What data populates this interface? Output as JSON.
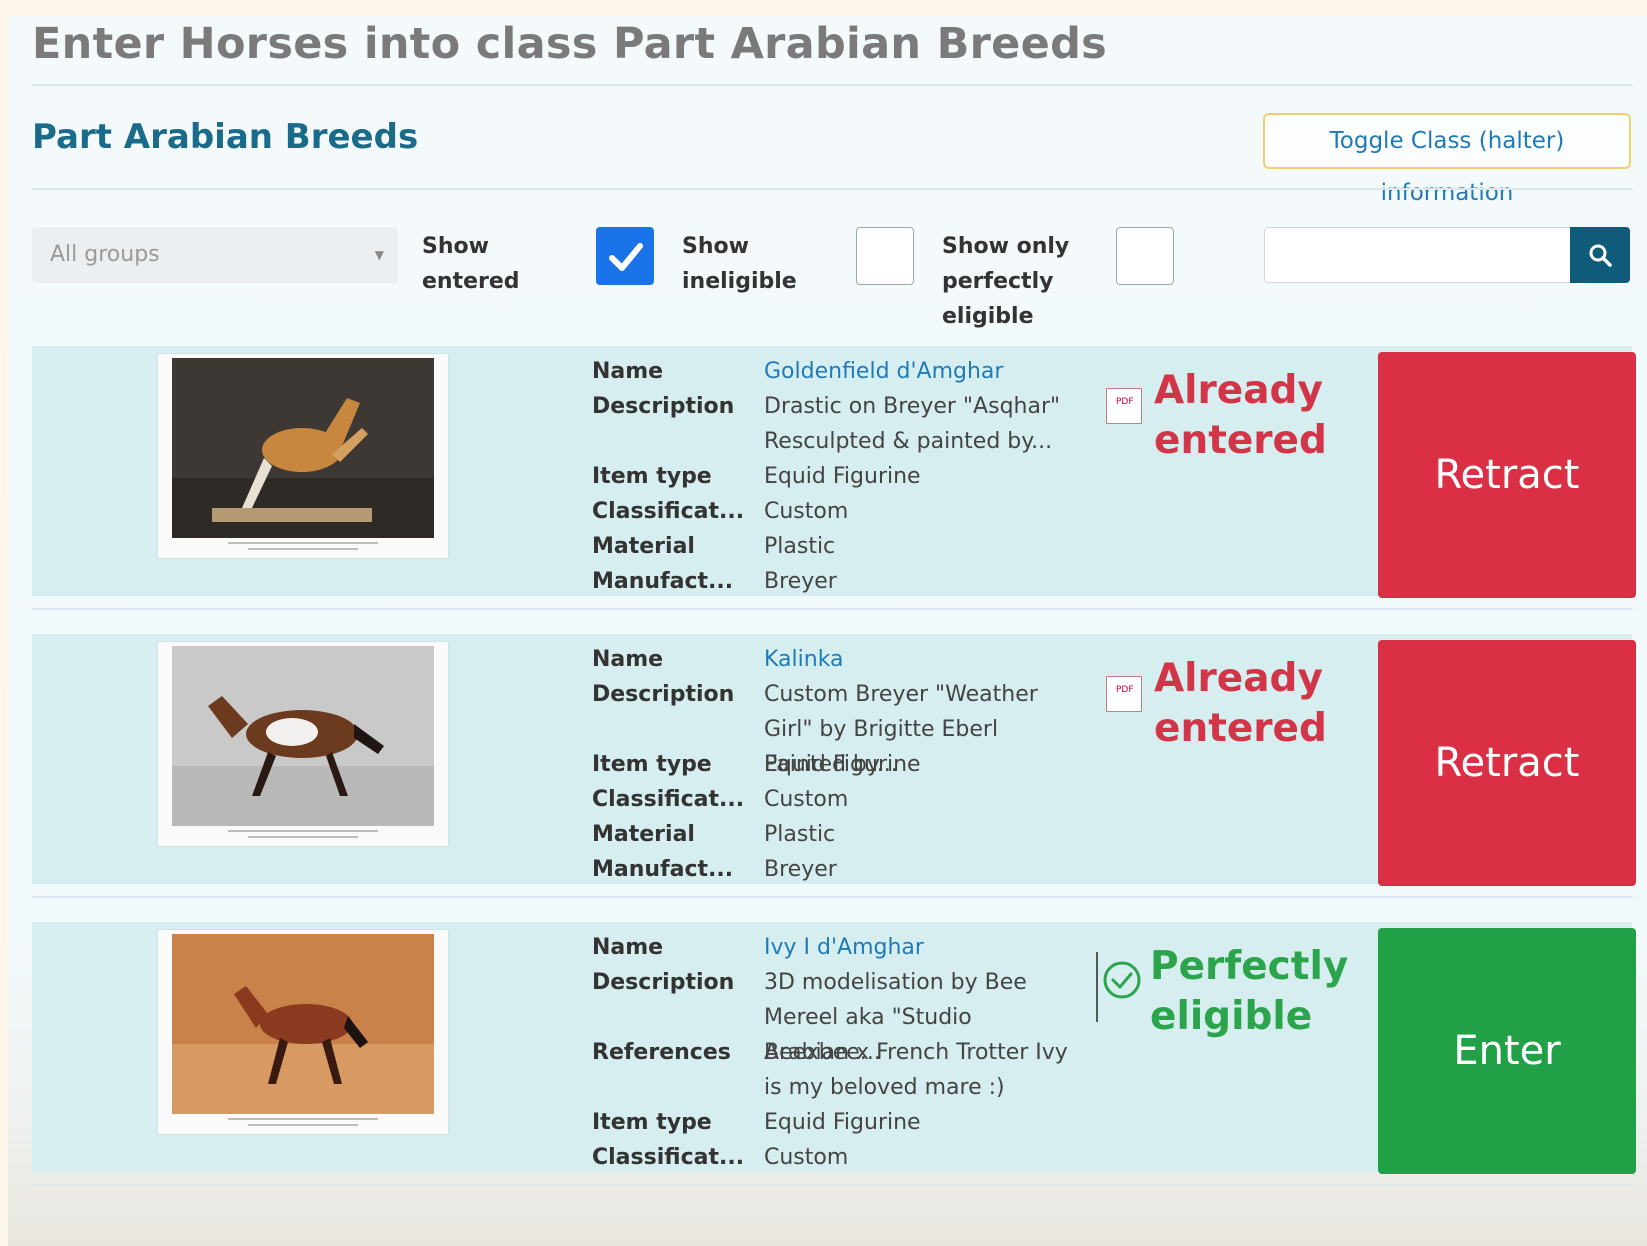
{
  "page_title": "Enter Horses into class Part Arabian Breeds",
  "class_title": "Part Arabian Breeds",
  "toggle_button": "Toggle Class (halter) information",
  "filters": {
    "group_select": "All groups",
    "show_entered": {
      "label": "Show entered",
      "checked": true
    },
    "show_ineligible": {
      "label": "Show ineligible",
      "checked": false
    },
    "show_perfect": {
      "label": "Show only perfectly eligible",
      "checked": false
    },
    "search_value": ""
  },
  "horses": [
    {
      "fields": [
        {
          "name": "Name",
          "value": "Goldenfield d'Amghar",
          "link": true
        },
        {
          "name": "Description",
          "value": "Drastic on Breyer \"Asqhar\" Resculpted & painted by..."
        },
        {
          "name": "Item type",
          "value": "Equid Figurine"
        },
        {
          "name": "Classificat...",
          "value": "Custom"
        },
        {
          "name": "Material",
          "value": "Plastic"
        },
        {
          "name": "Manufact...",
          "value": "Breyer"
        }
      ],
      "status": "Already entered",
      "status_color": "#d23548",
      "action": "Retract",
      "action_color": "#da2f44"
    },
    {
      "fields": [
        {
          "name": "Name",
          "value": "Kalinka",
          "link": true
        },
        {
          "name": "Description",
          "value": "Custom Breyer \"Weather Girl\" by Brigitte Eberl Painted by..."
        },
        {
          "name": "Item type",
          "value": "Equid Figurine"
        },
        {
          "name": "Classificat...",
          "value": "Custom"
        },
        {
          "name": "Material",
          "value": "Plastic"
        },
        {
          "name": "Manufact...",
          "value": "Breyer"
        }
      ],
      "status": "Already entered",
      "status_color": "#d23548",
      "action": "Retract",
      "action_color": "#da2f44"
    },
    {
      "fields": [
        {
          "name": "Name",
          "value": "Ivy I d'Amghar",
          "link": true
        },
        {
          "name": "Description",
          "value": "3D modelisation by Bee Mereel aka \"Studio Beexbee..."
        },
        {
          "name": "References",
          "value": "Arabian x French Trotter Ivy is my beloved mare :)"
        },
        {
          "name": "Item type",
          "value": "Equid Figurine"
        },
        {
          "name": "Classificat...",
          "value": "Custom"
        }
      ],
      "status": "Perfectly eligible",
      "status_color": "#2ba44b",
      "action": "Enter",
      "action_color": "#21a047"
    }
  ],
  "icons": {
    "search": "search-icon",
    "check": "checkmark-icon",
    "pdf": "pdf-file-icon",
    "eligible": "check-circle-icon",
    "dropdown": "chevron-down-icon"
  }
}
